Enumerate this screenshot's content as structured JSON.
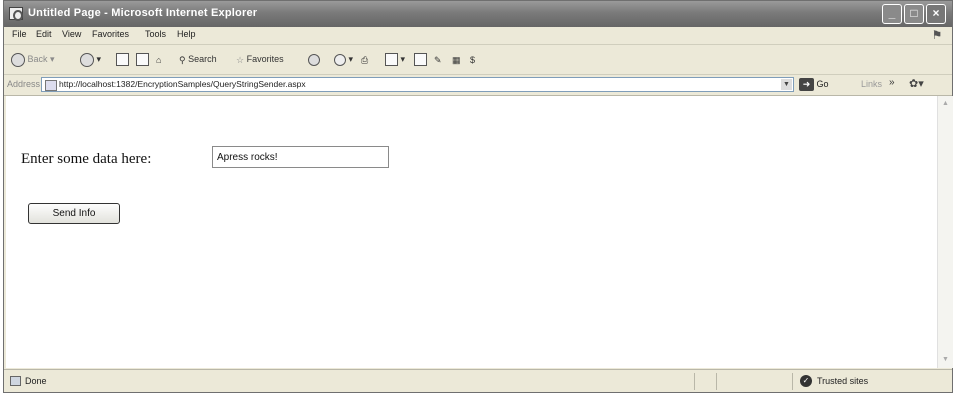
{
  "window": {
    "title": "Untitled Page - Microsoft Internet Explorer",
    "min": "_",
    "max": "□",
    "close": "×"
  },
  "menu": [
    "File",
    "Edit",
    "View",
    "Favorites",
    "Tools",
    "Help"
  ],
  "toolbar": {
    "back_label": "Back",
    "search_label": "Search",
    "favorites_label": "Favorites"
  },
  "address": {
    "label": "Address",
    "url": "http://localhost:1382/EncryptionSamples/QueryStringSender.aspx",
    "go_label": "Go",
    "links_label": "Links"
  },
  "form": {
    "prompt": "Enter some data here:",
    "input_value": "Apress rocks!",
    "button_label": "Send Info"
  },
  "status": {
    "text": "Done",
    "zone": "Trusted sites"
  }
}
